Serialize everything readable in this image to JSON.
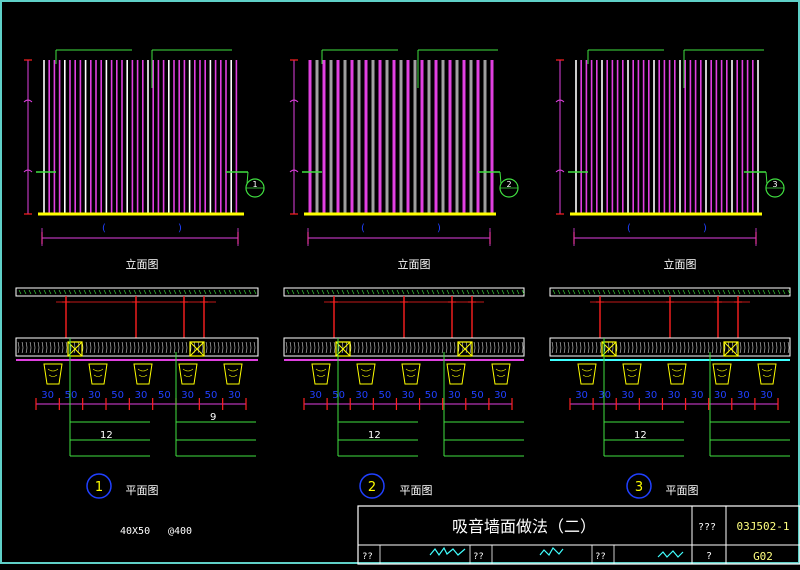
{
  "panels": [
    {
      "id": "1",
      "elevation_label": "立面图",
      "plan_label": "平面图",
      "plan_number": "1",
      "dims": [
        "30",
        "50",
        "30",
        "50",
        "30",
        "50",
        "30",
        "50",
        "30"
      ],
      "callout_left": "12",
      "callout_right": "9"
    },
    {
      "id": "2",
      "elevation_label": "立面图",
      "plan_label": "平面图",
      "plan_number": "2",
      "dims": [
        "30",
        "50",
        "30",
        "50",
        "30",
        "50",
        "30",
        "50",
        "30"
      ],
      "callout_left": "12",
      "callout_right": ""
    },
    {
      "id": "3",
      "elevation_label": "立面图",
      "plan_label": "平面图",
      "plan_number": "3",
      "dims": [
        "30",
        "30",
        "30",
        "30",
        "30",
        "30",
        "30",
        "30",
        "30"
      ],
      "callout_left": "12",
      "callout_right": ""
    }
  ],
  "notes": {
    "batten": "40X50",
    "spacing": "@400"
  },
  "title_block": {
    "title": "吸音墙面做法（二）",
    "atlas_label": "???",
    "atlas_code": "03J502-1",
    "page_label": "?",
    "page_code": "G02",
    "row2": [
      "??",
      "??",
      "??",
      "??"
    ]
  },
  "colors": {
    "magenta": "#e040e0",
    "green": "#40e040",
    "yellow": "#ffff00",
    "red": "#ff2020",
    "blue": "#2040ff",
    "cyan": "#40ffff",
    "white": "#ffffff",
    "grey": "#a0a0a0"
  }
}
